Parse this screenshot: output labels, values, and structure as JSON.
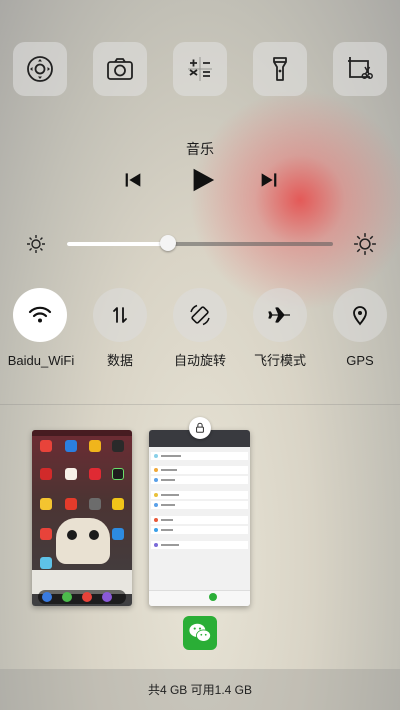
{
  "quick_tiles": [
    {
      "name": "assistive-touch",
      "icon": "joystick-icon"
    },
    {
      "name": "camera",
      "icon": "camera-icon"
    },
    {
      "name": "calculator",
      "icon": "calculator-icon"
    },
    {
      "name": "flashlight",
      "icon": "flashlight-icon"
    },
    {
      "name": "screenshot",
      "icon": "screenshot-scissors-icon"
    }
  ],
  "music": {
    "title": "音乐"
  },
  "brightness": {
    "level": 0.38
  },
  "toggles": [
    {
      "label": "Baidu_WiFi",
      "icon": "wifi-icon",
      "on": true
    },
    {
      "label": "数据",
      "icon": "mobile-data-icon",
      "on": false
    },
    {
      "label": "自动旋转",
      "icon": "auto-rotate-icon",
      "on": false
    },
    {
      "label": "飞行模式",
      "icon": "airplane-icon",
      "on": false
    },
    {
      "label": "GPS",
      "icon": "location-pin-icon",
      "on": false
    }
  ],
  "recent_apps": [
    {
      "name": "home-screen",
      "icon": "launcher-icon"
    },
    {
      "name": "wechat",
      "icon": "wechat-icon",
      "locked": true
    }
  ],
  "memory": {
    "text": "共4 GB 可用1.4 GB"
  },
  "colors": {
    "tile_bg": "#e1e1e1",
    "wechat_green": "#2aae36",
    "active_toggle": "#ffffff",
    "ambient_red": "#e84646"
  }
}
